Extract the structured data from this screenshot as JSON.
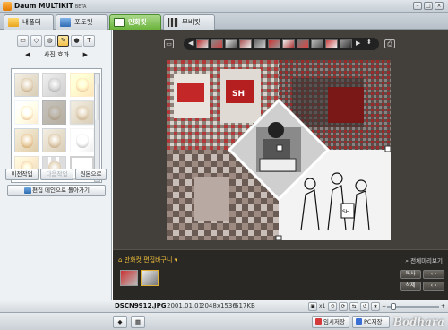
{
  "app": {
    "title": "Daum MULTIKIT",
    "badge": "BETA"
  },
  "window_controls": [
    "minimize-icon",
    "maximize-icon",
    "close-icon"
  ],
  "tabs": [
    {
      "label": "내폴더",
      "icon": "folder-icon",
      "active": false
    },
    {
      "label": "포토킷",
      "icon": "photo-icon",
      "active": false
    },
    {
      "label": "만화킷",
      "icon": "comic-icon",
      "active": true
    },
    {
      "label": "무비킷",
      "icon": "movie-icon",
      "active": false
    }
  ],
  "left_panel": {
    "tools": [
      {
        "icon": "frame-icon"
      },
      {
        "icon": "shape-icon"
      },
      {
        "icon": "bubble-icon"
      },
      {
        "icon": "brush-icon",
        "selected": true
      },
      {
        "icon": "circle-icon"
      },
      {
        "label": "T",
        "icon": "text-icon"
      }
    ],
    "effect_label": "사진 효과",
    "undo_label": "이전작업",
    "redo_label": "다음작업",
    "original_label": "원본으로",
    "back_label": "편집 메인으로 돌아가기"
  },
  "basket": {
    "label": "만화컷 편집바구니",
    "view_all": "전체미리보기",
    "copy": "복사",
    "delete": "삭제"
  },
  "status": {
    "filename": "DSCN9912.JPG",
    "date": "2001.01.01",
    "resolution": "2048x1536",
    "size": "617KB",
    "zoom_label": "x1"
  },
  "bottom": {
    "temp_save": "임시저장",
    "pc_save": "PC저장"
  },
  "watermark": "Bodhara",
  "colors": {
    "active_tab": "#6bb43c",
    "editor_bg": "#43403c",
    "basket_bg": "#2a2825",
    "basket_label": "#f0c23c"
  }
}
